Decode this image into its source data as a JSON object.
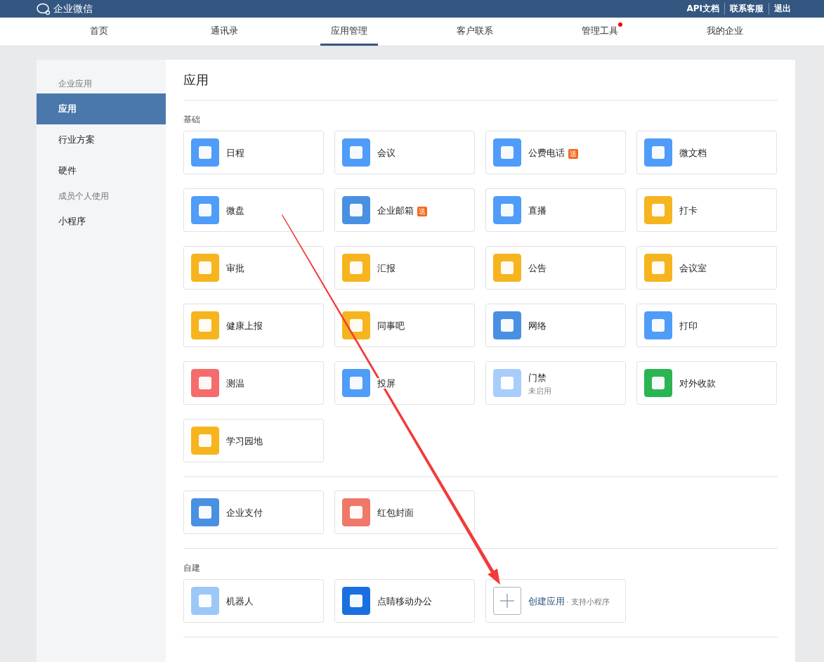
{
  "header": {
    "logo_text": "企业微信",
    "links": [
      "API文档",
      "联系客服",
      "退出"
    ]
  },
  "nav": [
    {
      "label": "首页",
      "selected": false,
      "dot": false
    },
    {
      "label": "通讯录",
      "selected": false,
      "dot": false
    },
    {
      "label": "应用管理",
      "selected": true,
      "dot": false
    },
    {
      "label": "客户联系",
      "selected": false,
      "dot": false
    },
    {
      "label": "管理工具",
      "selected": false,
      "dot": true
    },
    {
      "label": "我的企业",
      "selected": false,
      "dot": false
    }
  ],
  "sidebar": {
    "groups": [
      {
        "heading": "企业应用",
        "items": [
          {
            "label": "应用",
            "selected": true
          },
          {
            "label": "行业方案",
            "selected": false
          },
          {
            "label": "硬件",
            "selected": false
          }
        ]
      },
      {
        "heading": "成员个人使用",
        "items": [
          {
            "label": "小程序",
            "selected": false
          }
        ]
      }
    ]
  },
  "content": {
    "title": "应用",
    "sections": [
      {
        "heading": "基础",
        "apps": [
          {
            "kind": "app",
            "name": "日程",
            "color": "#4f9cf9"
          },
          {
            "kind": "app",
            "name": "会议",
            "color": "#4f9cf9"
          },
          {
            "kind": "app",
            "name": "公费电话",
            "color": "#4f9cf9",
            "badge": "送"
          },
          {
            "kind": "app",
            "name": "微文档",
            "color": "#4f9cf9"
          },
          {
            "kind": "app",
            "name": "微盘",
            "color": "#4f9cf9"
          },
          {
            "kind": "app",
            "name": "企业邮箱",
            "color": "#4a90e2",
            "badge": "送"
          },
          {
            "kind": "app",
            "name": "直播",
            "color": "#4f9cf9"
          },
          {
            "kind": "app",
            "name": "打卡",
            "color": "#f6b51e"
          },
          {
            "kind": "app",
            "name": "审批",
            "color": "#f6b51e"
          },
          {
            "kind": "app",
            "name": "汇报",
            "color": "#f6b51e"
          },
          {
            "kind": "app",
            "name": "公告",
            "color": "#f6b51e"
          },
          {
            "kind": "app",
            "name": "会议室",
            "color": "#f6b51e"
          },
          {
            "kind": "app",
            "name": "健康上报",
            "color": "#f6b51e"
          },
          {
            "kind": "app",
            "name": "同事吧",
            "color": "#f6b51e"
          },
          {
            "kind": "app",
            "name": "网络",
            "color": "#4a90e2"
          },
          {
            "kind": "app",
            "name": "打印",
            "color": "#4f9cf9"
          },
          {
            "kind": "app",
            "name": "测温",
            "color": "#f66b6b"
          },
          {
            "kind": "app",
            "name": "投屏",
            "color": "#4f9cf9"
          },
          {
            "kind": "app",
            "name": "门禁",
            "color": "#a9cdfb",
            "status": "未启用"
          },
          {
            "kind": "app",
            "name": "对外收款",
            "color": "#2bb552"
          },
          {
            "kind": "app",
            "name": "学习园地",
            "color": "#f6b51e"
          }
        ]
      },
      {
        "apps": [
          {
            "kind": "app",
            "name": "企业支付",
            "color": "#4a90e2"
          },
          {
            "kind": "app",
            "name": "红包封面",
            "color": "#f07868"
          }
        ]
      },
      {
        "heading": "自建",
        "apps": [
          {
            "kind": "app",
            "name": "机器人",
            "color": "#9cc8f8"
          },
          {
            "kind": "app",
            "name": "点睛移动办公",
            "color": "#1a6fe0"
          },
          {
            "kind": "create",
            "name": "创建应用",
            "note": "· 支持小程序"
          }
        ]
      }
    ]
  }
}
